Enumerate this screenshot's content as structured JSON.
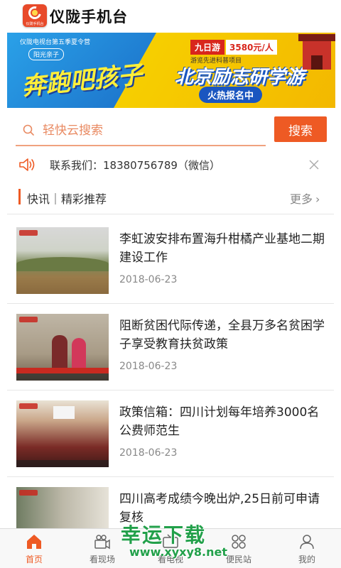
{
  "header": {
    "app_title": "仪陇手机台",
    "logo_subtext": "仪陇手机台"
  },
  "banner": {
    "top_line": "仪陇电视台第五季夏令营",
    "badge": "阳光亲子",
    "slogan": "奔跑吧孩子",
    "trip": "九日游",
    "price": "3580元/人",
    "subline": "游览先进科普项目",
    "main": "北京励志研学游",
    "cta": "火热报名中"
  },
  "search": {
    "placeholder": "轻快云搜索",
    "button_label": "搜索"
  },
  "notice": {
    "text": "联系我们：18380756789（微信）"
  },
  "section": {
    "title": "快讯｜精彩推荐",
    "more_label": "更多",
    "more_chevron": "›"
  },
  "news": [
    {
      "title": "李虹波安排布置海升柑橘产业基地二期建设工作",
      "date": "2018-06-23"
    },
    {
      "title": "阻断贫困代际传递，全县万多名贫困学子享受教育扶贫政策",
      "date": "2018-06-23"
    },
    {
      "title": "政策信箱：四川计划每年培养3000名公费师范生",
      "date": "2018-06-23"
    },
    {
      "title": "四川高考成绩今晚出炉,25日前可申请复核",
      "date": ""
    }
  ],
  "tabbar": {
    "tabs": [
      {
        "label": "首页",
        "icon": "home-icon"
      },
      {
        "label": "看现场",
        "icon": "video-icon"
      },
      {
        "label": "看电视",
        "icon": "tv-icon"
      },
      {
        "label": "便民站",
        "icon": "grid-icon"
      },
      {
        "label": "我的",
        "icon": "user-icon"
      }
    ],
    "active_color": "#ee5a24"
  },
  "watermark": {
    "text": "幸运下载",
    "url": "www.xyxy8.net"
  },
  "colors": {
    "accent": "#ee5a24",
    "search_text": "#e98a62"
  }
}
